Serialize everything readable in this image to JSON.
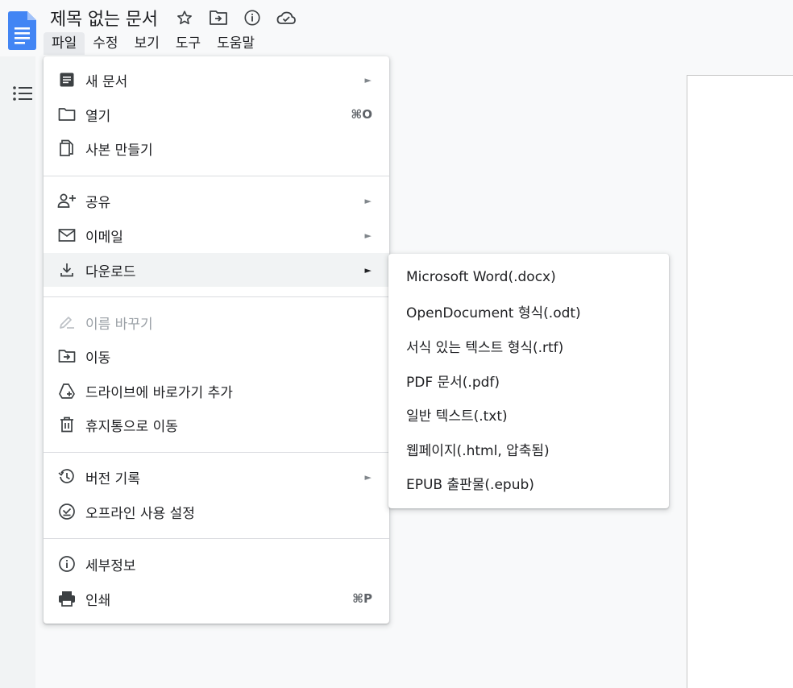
{
  "header": {
    "title": "제목 없는 문서",
    "icons": [
      "star-icon",
      "move-folder-icon",
      "info-icon",
      "cloud-icon"
    ],
    "menus": [
      {
        "label": "파일",
        "active": true
      },
      {
        "label": "수정"
      },
      {
        "label": "보기"
      },
      {
        "label": "도구"
      },
      {
        "label": "도움말"
      }
    ]
  },
  "file_menu": {
    "items": [
      {
        "label": "새 문서",
        "icon": "document-icon",
        "submenu": true
      },
      {
        "label": "열기",
        "icon": "folder-icon",
        "shortcut": "⌘O"
      },
      {
        "label": "사본 만들기",
        "icon": "copy-icon"
      },
      {
        "label": "공유",
        "icon": "add-person-icon",
        "submenu": true
      },
      {
        "label": "이메일",
        "icon": "email-icon",
        "submenu": true
      },
      {
        "label": "다운로드",
        "icon": "download-icon",
        "submenu": true,
        "highlighted": true
      },
      {
        "label": "이름 바꾸기",
        "icon": "rename-icon",
        "disabled": true
      },
      {
        "label": "이동",
        "icon": "move-folder-icon"
      },
      {
        "label": "드라이브에 바로가기 추가",
        "icon": "drive-shortcut-icon"
      },
      {
        "label": "휴지통으로 이동",
        "icon": "trash-icon"
      },
      {
        "label": "버전 기록",
        "icon": "history-icon",
        "submenu": true
      },
      {
        "label": "오프라인 사용 설정",
        "icon": "offline-check-icon"
      },
      {
        "label": "세부정보",
        "icon": "info-icon"
      },
      {
        "label": "인쇄",
        "icon": "print-icon",
        "shortcut": "⌘P"
      }
    ],
    "arrow_glyph": "►"
  },
  "download_submenu": {
    "items": [
      "Microsoft Word(.docx)",
      "OpenDocument 형식(.odt)",
      "서식 있는 텍스트 형식(.rtf)",
      "PDF 문서(.pdf)",
      "일반 텍스트(.txt)",
      "웹페이지(.html, 압축됨)",
      "EPUB 출판물(.epub)"
    ]
  },
  "colors": {
    "accent": "#4285f4",
    "icon": "#5f6368",
    "disabled": "#9aa0a6",
    "highlight": "#f1f3f4"
  }
}
